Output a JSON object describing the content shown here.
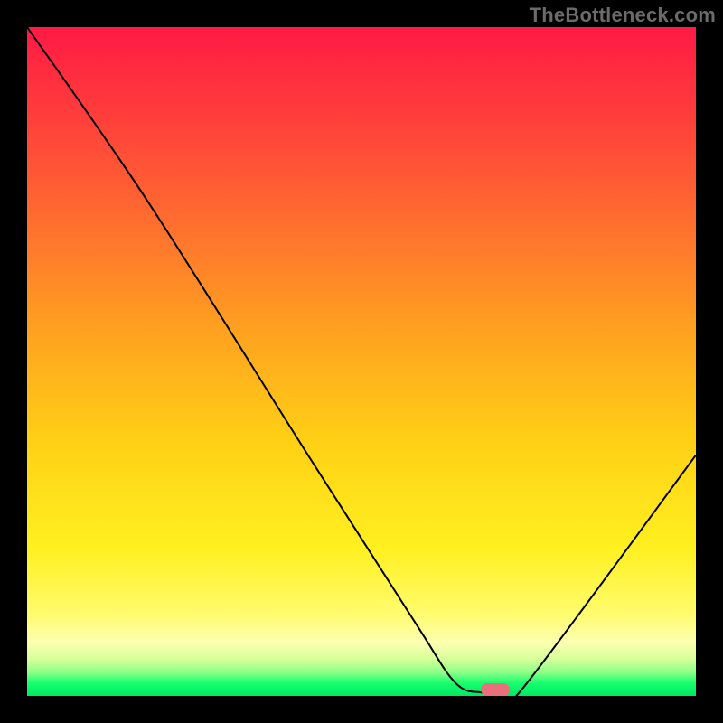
{
  "watermark": "TheBottleneck.com",
  "chart_data": {
    "type": "line",
    "title": "",
    "xlabel": "",
    "ylabel": "",
    "xlim": [
      0,
      100
    ],
    "ylim": [
      0,
      100
    ],
    "grid": false,
    "series": [
      {
        "name": "curve",
        "x": [
          0,
          18,
          42,
          58,
          64,
          68,
          71,
          74,
          100
        ],
        "values": [
          100,
          74,
          36,
          11,
          2,
          0.5,
          0.5,
          1,
          36
        ]
      }
    ],
    "marker": {
      "x": 70,
      "y": 1,
      "color": "#e96f7a"
    },
    "background_gradient_stops": [
      {
        "pos": 0,
        "color": "#ff1a44"
      },
      {
        "pos": 0.12,
        "color": "#ff3a3c"
      },
      {
        "pos": 0.28,
        "color": "#ff6a30"
      },
      {
        "pos": 0.45,
        "color": "#ffa020"
      },
      {
        "pos": 0.62,
        "color": "#ffd015"
      },
      {
        "pos": 0.78,
        "color": "#fff020"
      },
      {
        "pos": 0.88,
        "color": "#fffc70"
      },
      {
        "pos": 0.92,
        "color": "#fcffb0"
      },
      {
        "pos": 0.945,
        "color": "#d6ff9a"
      },
      {
        "pos": 0.965,
        "color": "#8cff88"
      },
      {
        "pos": 0.98,
        "color": "#1aff70"
      },
      {
        "pos": 1.0,
        "color": "#00e860"
      }
    ]
  }
}
